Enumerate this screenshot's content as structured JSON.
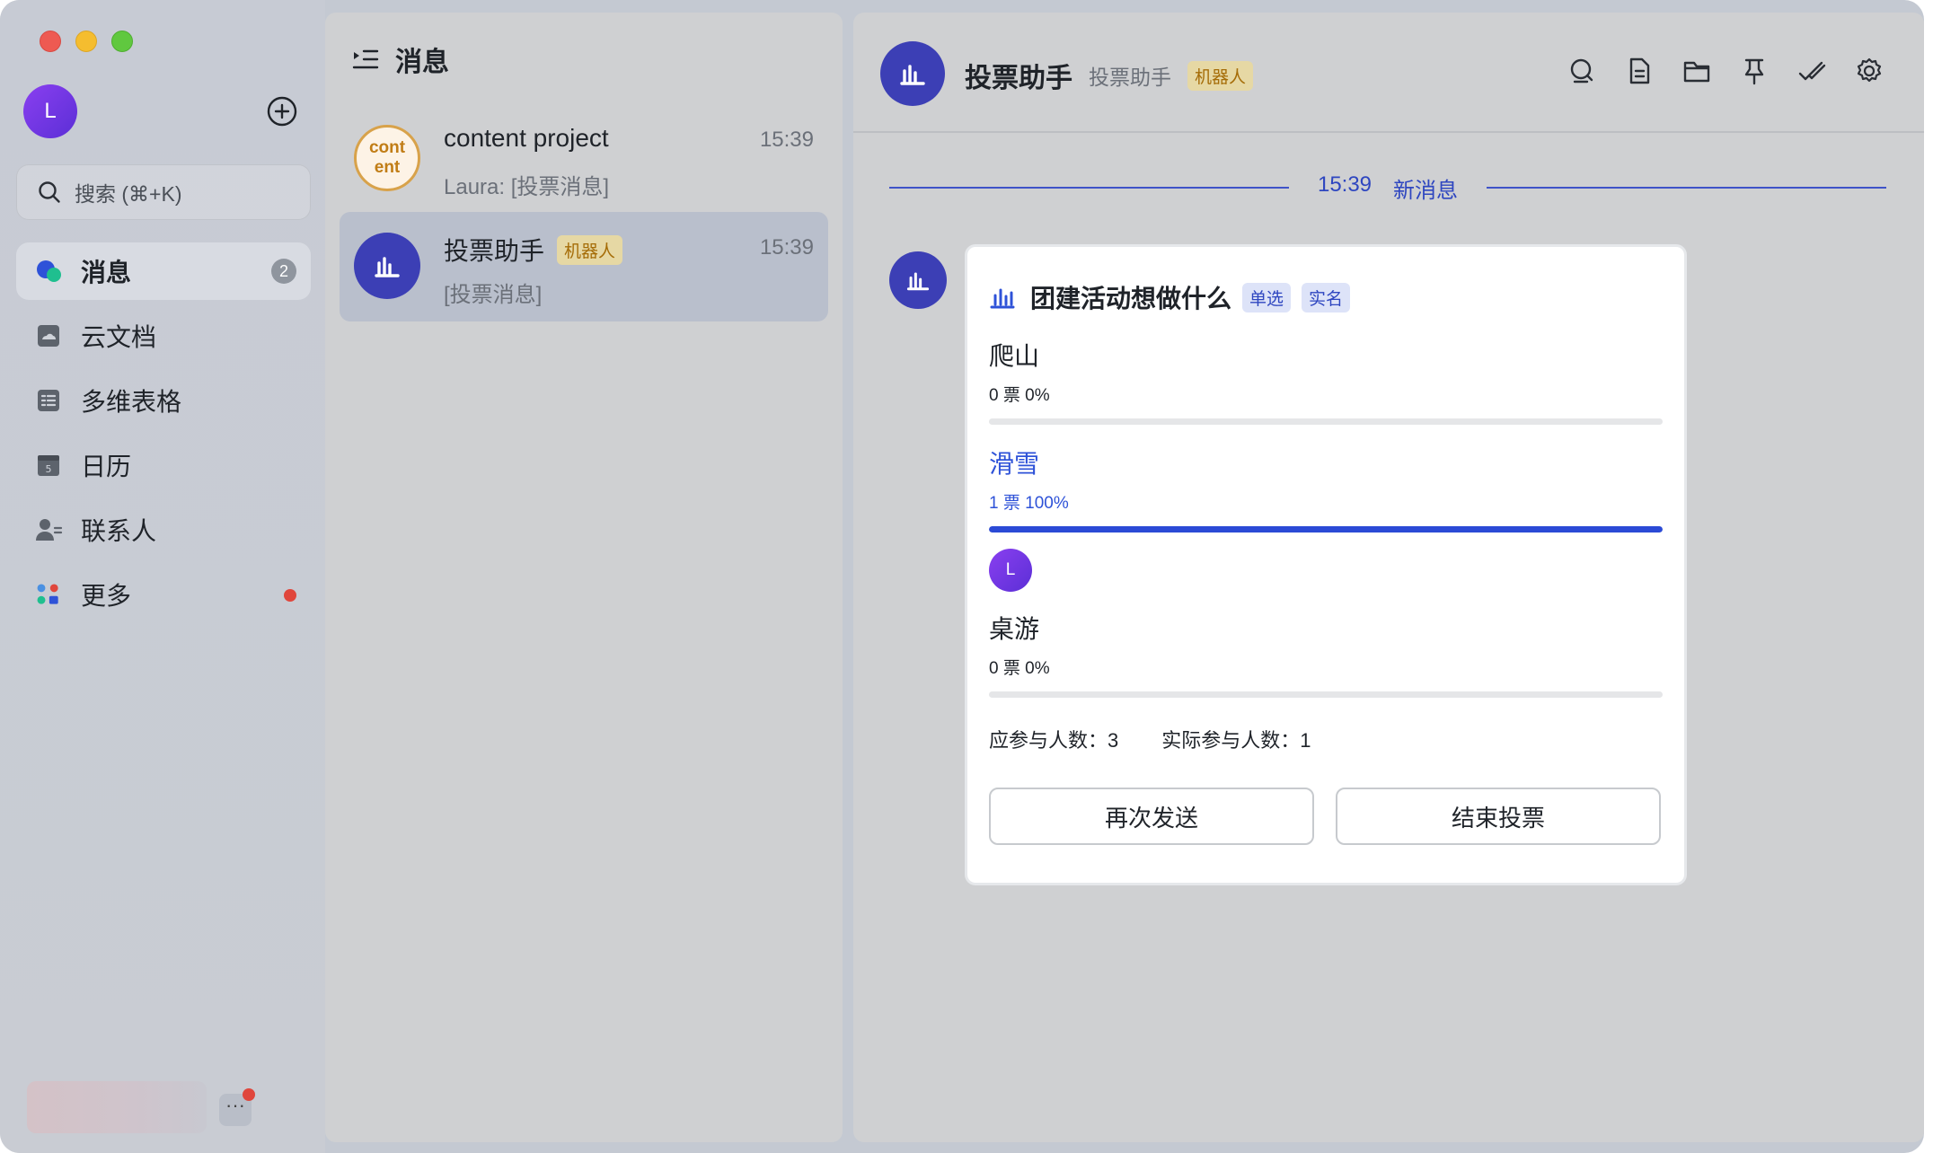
{
  "sidebar": {
    "avatar_initial": "L",
    "search_placeholder": "搜索 (⌘+K)",
    "items": [
      {
        "label": "消息",
        "icon": "chat-bubbles-icon",
        "badge": "2",
        "active": true
      },
      {
        "label": "云文档",
        "icon": "cloud-doc-icon"
      },
      {
        "label": "多维表格",
        "icon": "multi-table-icon"
      },
      {
        "label": "日历",
        "icon": "calendar-icon"
      },
      {
        "label": "联系人",
        "icon": "contacts-icon"
      },
      {
        "label": "更多",
        "icon": "apps-more-icon",
        "dot": true
      }
    ],
    "more_label": "···"
  },
  "chat_list": {
    "title": "消息",
    "chats": [
      {
        "avatar_text": "cont ent",
        "title": "content project",
        "preview": "Laura: [投票消息]",
        "time": "15:39"
      },
      {
        "title": "投票助手",
        "tag": "机器人",
        "preview": "[投票消息]",
        "time": "15:39",
        "selected": true
      }
    ]
  },
  "conversation": {
    "name": "投票助手",
    "subtitle": "投票助手",
    "tag": "机器人",
    "tools": [
      "search-icon",
      "document-icon",
      "folder-icon",
      "pin-icon",
      "check-mark-icon",
      "settings-icon"
    ],
    "divider_time": "15:39",
    "divider_label": "新消息",
    "poll": {
      "title": "团建活动想做什么",
      "tags": [
        "单选",
        "实名"
      ],
      "options": [
        {
          "name": "爬山",
          "stat": "0 票 0%",
          "fraction": 0
        },
        {
          "name": "滑雪",
          "stat": "1 票 100%",
          "fraction": 1,
          "chosen": true,
          "voter_initial": "L"
        },
        {
          "name": "桌游",
          "stat": "0 票 0%",
          "fraction": 0
        }
      ],
      "expected": "应参与人数：3",
      "actual": "实际参与人数：1",
      "resend_label": "再次发送",
      "end_label": "结束投票"
    }
  },
  "colors": {
    "accent": "#2b4ad6",
    "bot_avatar": "#3c3fb5",
    "bot_tag": "#e6d8a4",
    "unread_dot": "#e0463c"
  }
}
